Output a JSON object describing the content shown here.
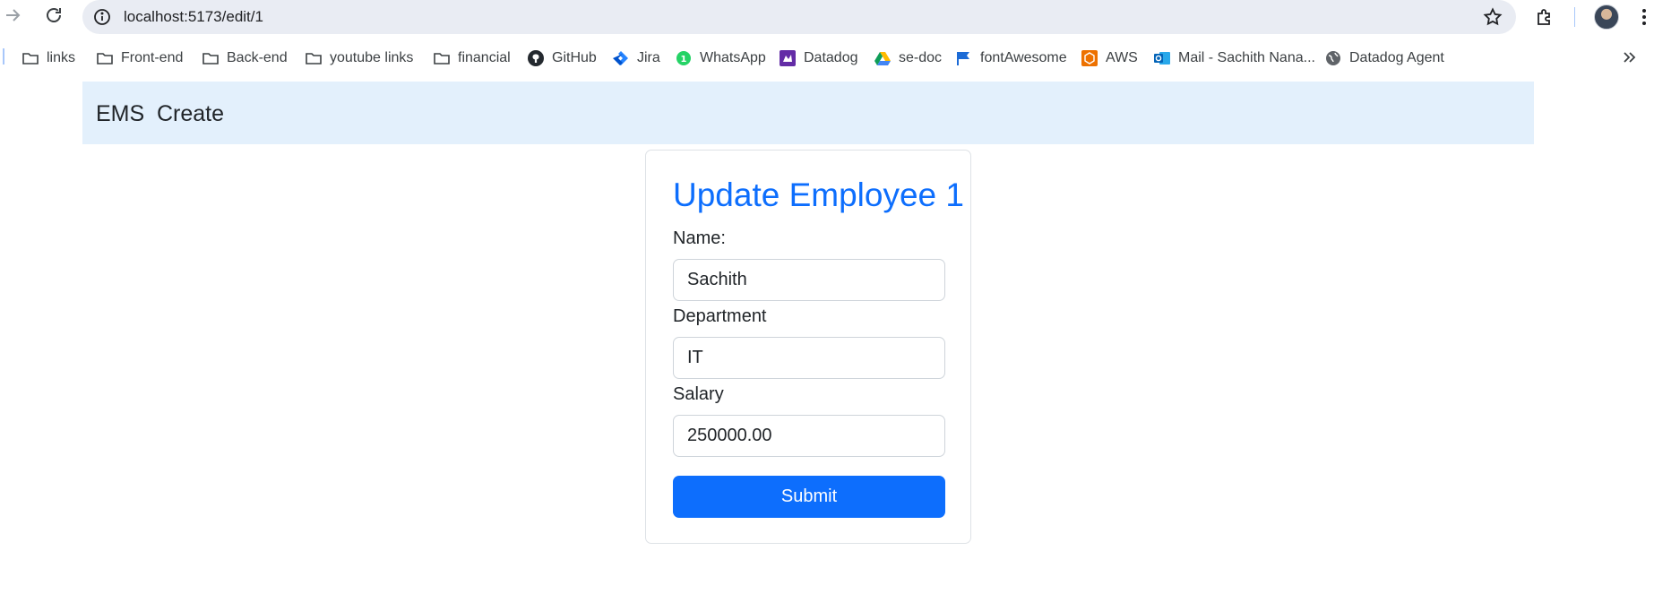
{
  "browser": {
    "url": "localhost:5173/edit/1",
    "icons": {
      "forward": "arrow-right-icon",
      "reload": "reload-icon",
      "site_info": "site-info-icon",
      "bookmark_star": "star-icon",
      "extensions": "puzzle-icon",
      "menu": "kebab-menu-icon",
      "more_bookmarks": "chevron-double-right-icon"
    }
  },
  "bookmarks": [
    {
      "label": "links",
      "icon": "folder-icon"
    },
    {
      "label": "Front-end",
      "icon": "folder-icon"
    },
    {
      "label": "Back-end",
      "icon": "folder-icon"
    },
    {
      "label": "youtube links",
      "icon": "folder-icon"
    },
    {
      "label": "financial",
      "icon": "folder-icon"
    },
    {
      "label": "GitHub",
      "icon": "github-icon"
    },
    {
      "label": "Jira",
      "icon": "jira-icon"
    },
    {
      "label": "WhatsApp",
      "icon": "whatsapp-icon"
    },
    {
      "label": "Datadog",
      "icon": "datadog-icon"
    },
    {
      "label": "se-doc",
      "icon": "google-drive-icon"
    },
    {
      "label": "fontAwesome",
      "icon": "flag-icon"
    },
    {
      "label": "AWS",
      "icon": "aws-icon"
    },
    {
      "label": "Mail - Sachith Nana...",
      "icon": "outlook-icon"
    },
    {
      "label": "Datadog Agent",
      "icon": "globe-icon"
    }
  ],
  "navbar": {
    "brand": "EMS",
    "create_link": "Create"
  },
  "form": {
    "title": "Update Employee 1",
    "name_label": "Name:",
    "name_value": "Sachith",
    "department_label": "Department",
    "department_value": "IT",
    "salary_label": "Salary",
    "salary_value": "250000.00",
    "submit_label": "Submit"
  },
  "colors": {
    "primary": "#0d6efd",
    "navbar_bg": "#e3f0fc",
    "omnibox_bg": "#e9ecf3"
  }
}
